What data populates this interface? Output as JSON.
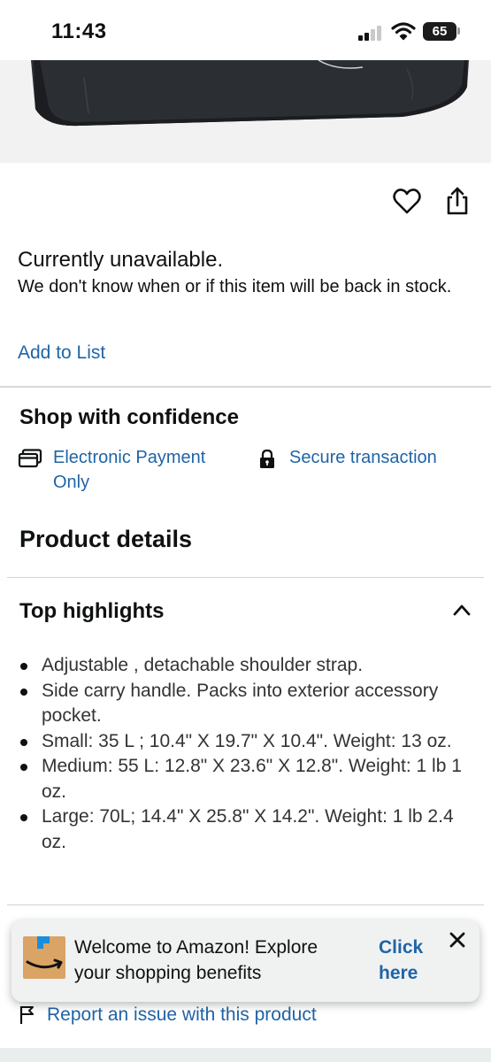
{
  "status_bar": {
    "time": "11:43",
    "battery": "65",
    "icons": [
      "cellular-signal-icon",
      "wifi-icon",
      "battery-icon"
    ]
  },
  "product": {
    "image_alt": "product-image-bag",
    "actions": [
      "heart-icon",
      "share-icon"
    ]
  },
  "availability": {
    "title": "Currently unavailable.",
    "message": "We don't know when or if this item will be back in stock.",
    "add_to_list": "Add to List"
  },
  "shop_confidence": {
    "title": "Shop with confidence",
    "payment": "Electronic Payment Only",
    "secure": "Secure transaction"
  },
  "product_details": {
    "title": "Product details"
  },
  "top_highlights": {
    "title": "Top highlights",
    "items": [
      "Adjustable , detachable shoulder strap.",
      "Side carry handle. Packs into exterior accessory pocket.",
      "Small: 35 L ; 10.4\" X 19.7\" X 10.4\". Weight: 13 oz.",
      "Medium: 55 L: 12.8\" X 23.6\" X 12.8\". Weight: 1 lb 1 oz.",
      "Large: 70L; 14.4\" X 25.8\" X 14.2\". Weight: 1 lb 2.4 oz."
    ]
  },
  "banner": {
    "text": "Welcome to Amazon! Explore your shopping benefits",
    "cta": "Click here"
  },
  "report": {
    "label": "Report an issue with this product"
  },
  "colors": {
    "link": "#1f64a7",
    "text": "#0f1111",
    "divider": "#d5d9d9",
    "banner_bg": "#f0f2f2"
  }
}
